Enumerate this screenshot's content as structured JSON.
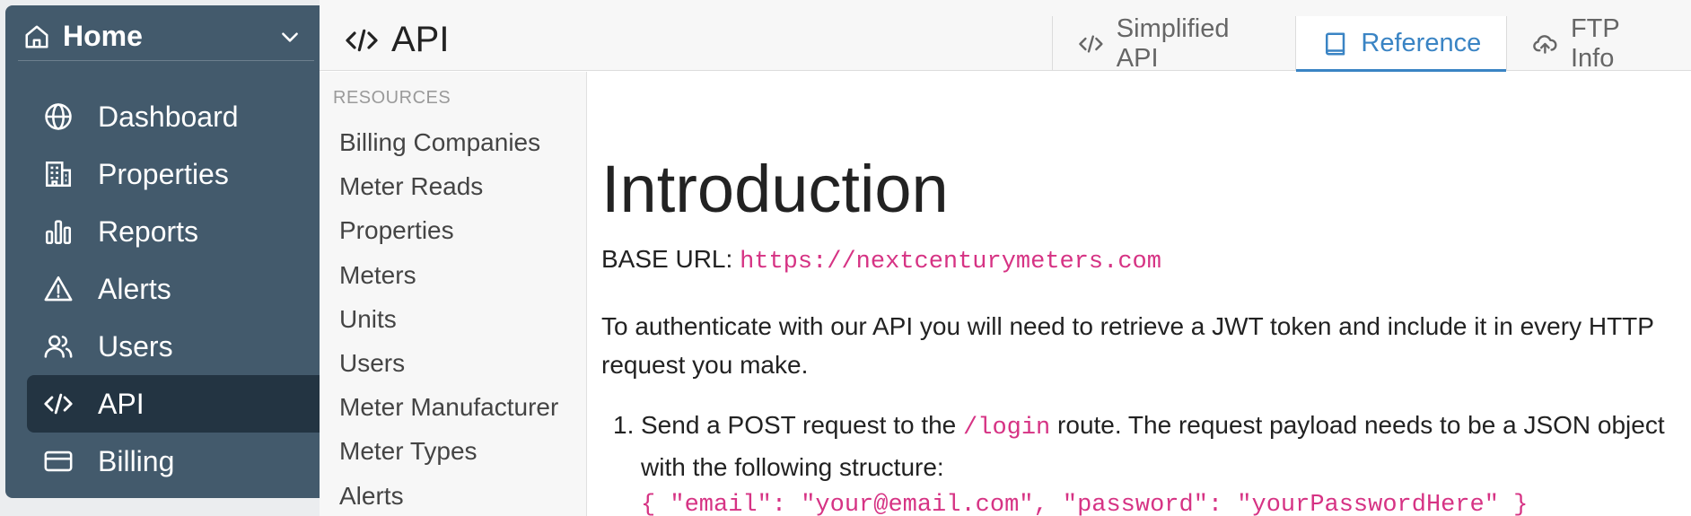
{
  "sidebar": {
    "home_label": "Home",
    "items": [
      {
        "label": "Dashboard",
        "icon": "globe-icon",
        "active": false
      },
      {
        "label": "Properties",
        "icon": "building-icon",
        "active": false
      },
      {
        "label": "Reports",
        "icon": "bar-chart-icon",
        "active": false
      },
      {
        "label": "Alerts",
        "icon": "warning-triangle-icon",
        "active": false
      },
      {
        "label": "Users",
        "icon": "users-icon",
        "active": false
      },
      {
        "label": "API",
        "icon": "code-icon",
        "active": true
      },
      {
        "label": "Billing",
        "icon": "credit-card-icon",
        "active": false
      }
    ]
  },
  "header": {
    "title": "API",
    "tabs": [
      {
        "label": "Simplified API",
        "icon": "code-icon",
        "active": false
      },
      {
        "label": "Reference",
        "icon": "book-icon",
        "active": true
      },
      {
        "label": "FTP Info",
        "icon": "cloud-upload-icon",
        "active": false
      }
    ]
  },
  "resources": {
    "heading": "RESOURCES",
    "items": [
      "Billing Companies",
      "Meter Reads",
      "Properties",
      "Meters",
      "Units",
      "Users",
      "Meter Manufacturer",
      "Meter Types",
      "Alerts"
    ]
  },
  "content": {
    "heading": "Introduction",
    "base_url_label": "BASE URL:",
    "base_url": "https://nextcenturymeters.com",
    "auth_text": "To authenticate with our API you will need to retrieve a JWT token and include it in every HTTP request you make.",
    "step1_number": "1.",
    "step1_prefix": "Send a POST request to the",
    "step1_route": "/login",
    "step1_suffix": "route. The request payload needs to be a JSON object with the following structure:",
    "step1_payload": "{ \"email\": \"your@email.com\", \"password\": \"yourPasswordHere\" }"
  },
  "colors": {
    "sidebar_bg": "#435a6c",
    "sidebar_active": "#233442",
    "accent": "#3a84c4",
    "code": "#d63384"
  }
}
